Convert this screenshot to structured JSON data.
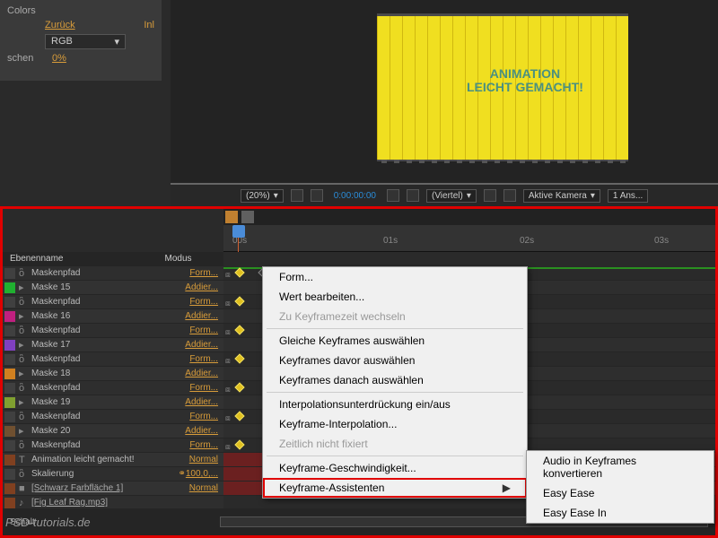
{
  "top_panel": {
    "colors_label": "Colors",
    "zuruck": "Zurück",
    "inl": "Inl",
    "rgb": "RGB",
    "schen": "schen",
    "pct": "0%"
  },
  "preview": {
    "text1": "ANIMATION",
    "text2": "LEICHT GEMACHT!",
    "bar": {
      "zoom": "(20%)",
      "time": "0:00:00:00",
      "quality": "(Viertel)",
      "camera": "Aktive Kamera",
      "views": "1 Ans..."
    }
  },
  "timeline_header": {
    "name": "Ebenenname",
    "mode": "Modus"
  },
  "layers": [
    {
      "type": "prop",
      "color": "#404040",
      "name": "Maskenpfad",
      "mode": "Form..."
    },
    {
      "type": "mask",
      "color": "#20b030",
      "name": "Maske 15",
      "mode": "Addier..."
    },
    {
      "type": "prop",
      "color": "#404040",
      "name": "Maskenpfad",
      "mode": "Form..."
    },
    {
      "type": "mask",
      "color": "#c02080",
      "name": "Maske 16",
      "mode": "Addier..."
    },
    {
      "type": "prop",
      "color": "#404040",
      "name": "Maskenpfad",
      "mode": "Form..."
    },
    {
      "type": "mask",
      "color": "#8040c0",
      "name": "Maske 17",
      "mode": "Addier..."
    },
    {
      "type": "prop",
      "color": "#404040",
      "name": "Maskenpfad",
      "mode": "Form..."
    },
    {
      "type": "mask",
      "color": "#d08020",
      "name": "Maske 18",
      "mode": "Addier..."
    },
    {
      "type": "prop",
      "color": "#404040",
      "name": "Maskenpfad",
      "mode": "Form..."
    },
    {
      "type": "mask",
      "color": "#80a030",
      "name": "Maske 19",
      "mode": "Addier..."
    },
    {
      "type": "prop",
      "color": "#404040",
      "name": "Maskenpfad",
      "mode": "Form..."
    },
    {
      "type": "mask",
      "color": "#705030",
      "name": "Maske 20",
      "mode": "Addier..."
    },
    {
      "type": "prop",
      "color": "#404040",
      "name": "Maskenpfad",
      "mode": "Form..."
    },
    {
      "type": "text",
      "color": "#804020",
      "name": "Animation leicht gemacht!",
      "mode": "Normal"
    },
    {
      "type": "scale",
      "color": "#404040",
      "name": "Skalierung",
      "mode": "100,0,..."
    },
    {
      "type": "solid",
      "color": "#804020",
      "name": "[Schwarz Farbfläche 1]",
      "mode": "Normal"
    },
    {
      "type": "audio",
      "color": "#804020",
      "name": "[Fig Leaf Rag.mp3]",
      "mode": ""
    }
  ],
  "ruler": {
    "t0": "00s",
    "t1": "01s",
    "t2": "02s",
    "t3": "03s"
  },
  "context_menu": [
    {
      "label": "Form...",
      "enabled": true
    },
    {
      "label": "Wert bearbeiten...",
      "enabled": true
    },
    {
      "label": "Zu Keyframezeit wechseln",
      "enabled": false
    },
    {
      "sep": true
    },
    {
      "label": "Gleiche Keyframes auswählen",
      "enabled": true
    },
    {
      "label": "Keyframes davor auswählen",
      "enabled": true
    },
    {
      "label": "Keyframes danach auswählen",
      "enabled": true
    },
    {
      "sep": true
    },
    {
      "label": "Interpolationsunterdrückung ein/aus",
      "enabled": true
    },
    {
      "label": "Keyframe-Interpolation...",
      "enabled": true
    },
    {
      "label": "Zeitlich nicht fixiert",
      "enabled": false
    },
    {
      "sep": true
    },
    {
      "label": "Keyframe-Geschwindigkeit...",
      "enabled": true
    },
    {
      "label": "Keyframe-Assistenten",
      "enabled": true,
      "highlight": true,
      "arrow": true
    }
  ],
  "submenu": [
    "Audio in Keyframes konvertieren",
    "Easy Ease",
    "Easy Ease In"
  ],
  "bottom_bar": {
    "schalt": "Schalt"
  },
  "watermark": "PSD-tutorials.de"
}
